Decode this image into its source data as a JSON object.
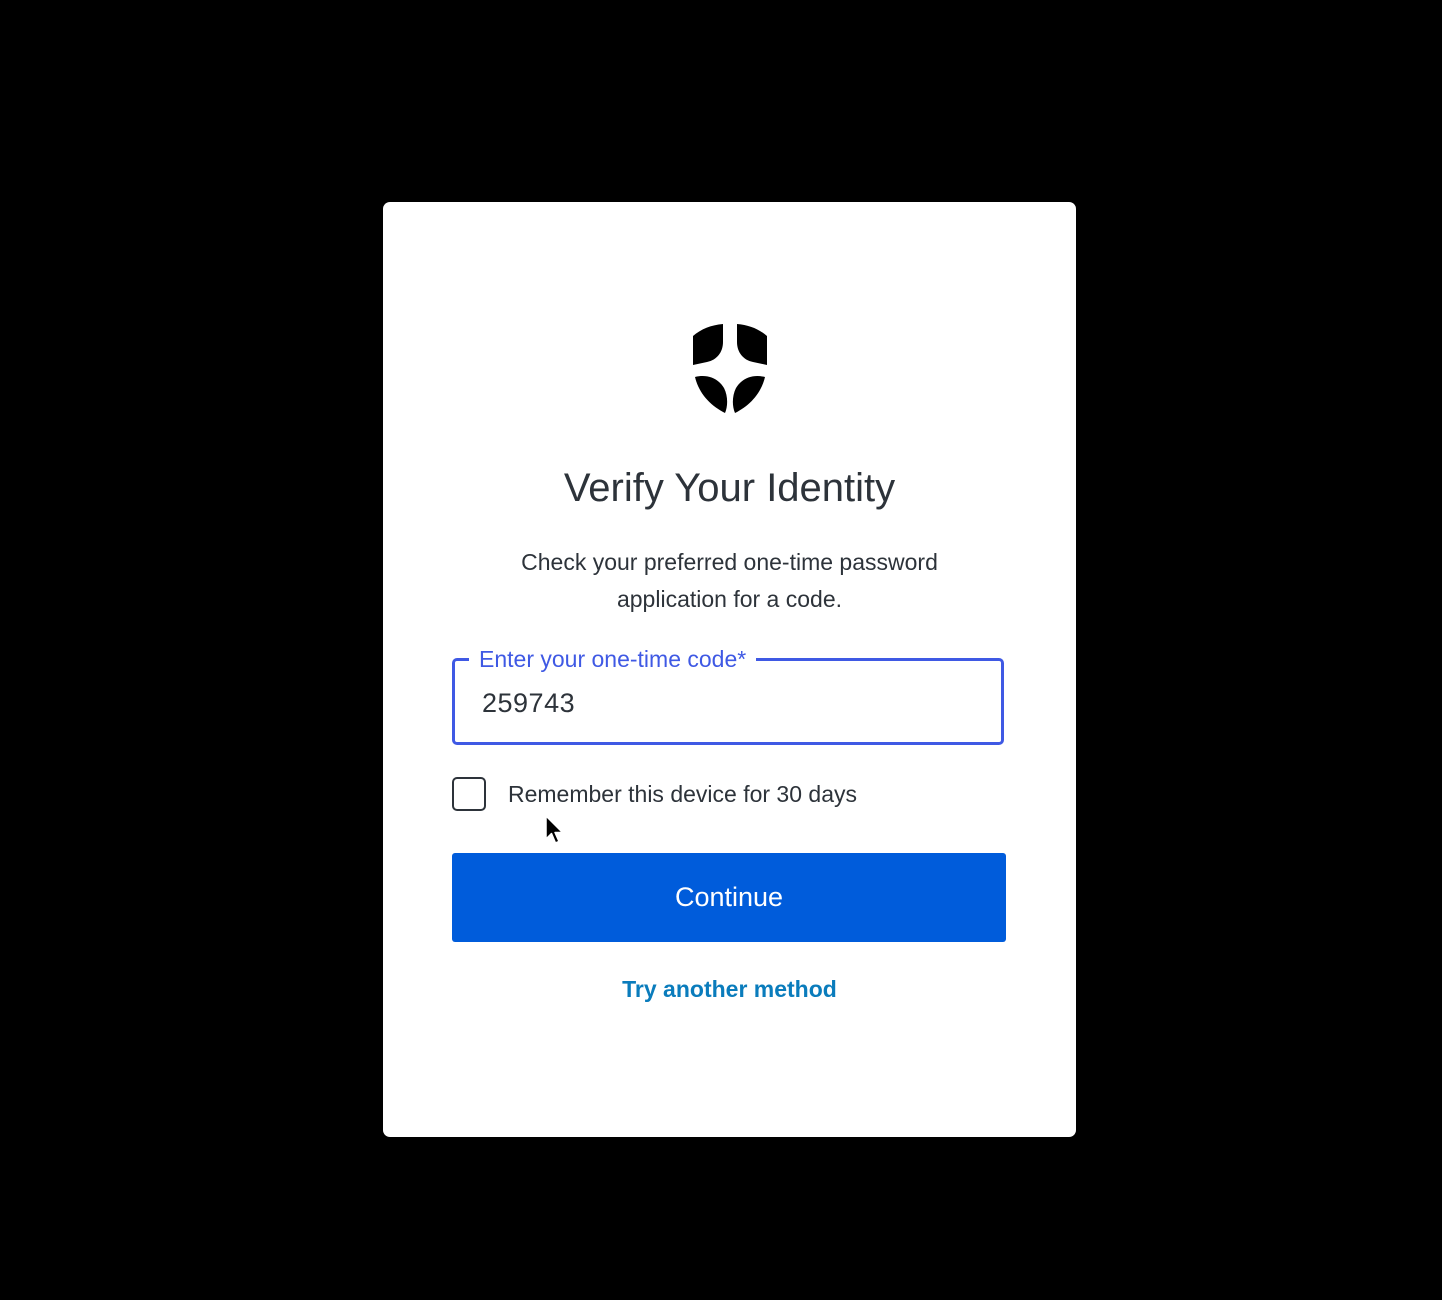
{
  "dialog": {
    "logo_icon": "shield-logo-icon",
    "title": "Verify Your Identity",
    "description": "Check your preferred one-time password application for a code.",
    "code_field": {
      "label": "Enter your one-time code*",
      "value": "259743",
      "accent_color": "#3f59e4"
    },
    "remember_device": {
      "label": "Remember this device for 30 days",
      "checked": false
    },
    "continue_label": "Continue",
    "continue_color": "#005cdb",
    "try_another_label": "Try another method",
    "link_color": "#0a7cbc"
  },
  "cursor_icon": "mouse-pointer-icon"
}
